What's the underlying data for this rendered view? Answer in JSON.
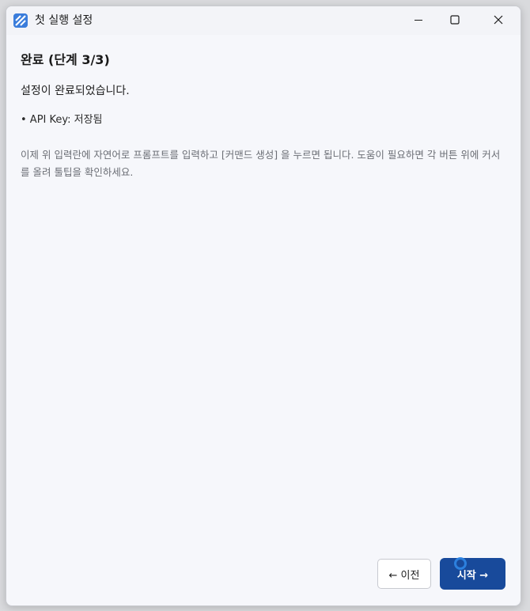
{
  "window": {
    "title": "첫 실행 설정",
    "icon": "app-logo-icon",
    "controls": {
      "minimize_icon": "minimize-icon",
      "maximize_icon": "maximize-icon",
      "close_icon": "close-icon"
    }
  },
  "main": {
    "heading": "완료 (단계 3/3)",
    "message": "설정이 완료되었습니다.",
    "bullet": "• API Key: 저장됨",
    "help": "이제 위 입력란에 자연어로 프롬프트를 입력하고 [커맨드 생성] 을 누르면 됩니다. 도움이 필요하면 각 버튼 위에 커서를 올려 툴팁을 확인하세요."
  },
  "footer": {
    "prev_label": "← 이전",
    "start_label": "시작 →"
  },
  "colors": {
    "accent": "#184a9b",
    "app_icon": "#3b7ddb",
    "background": "#f6f7fb"
  }
}
